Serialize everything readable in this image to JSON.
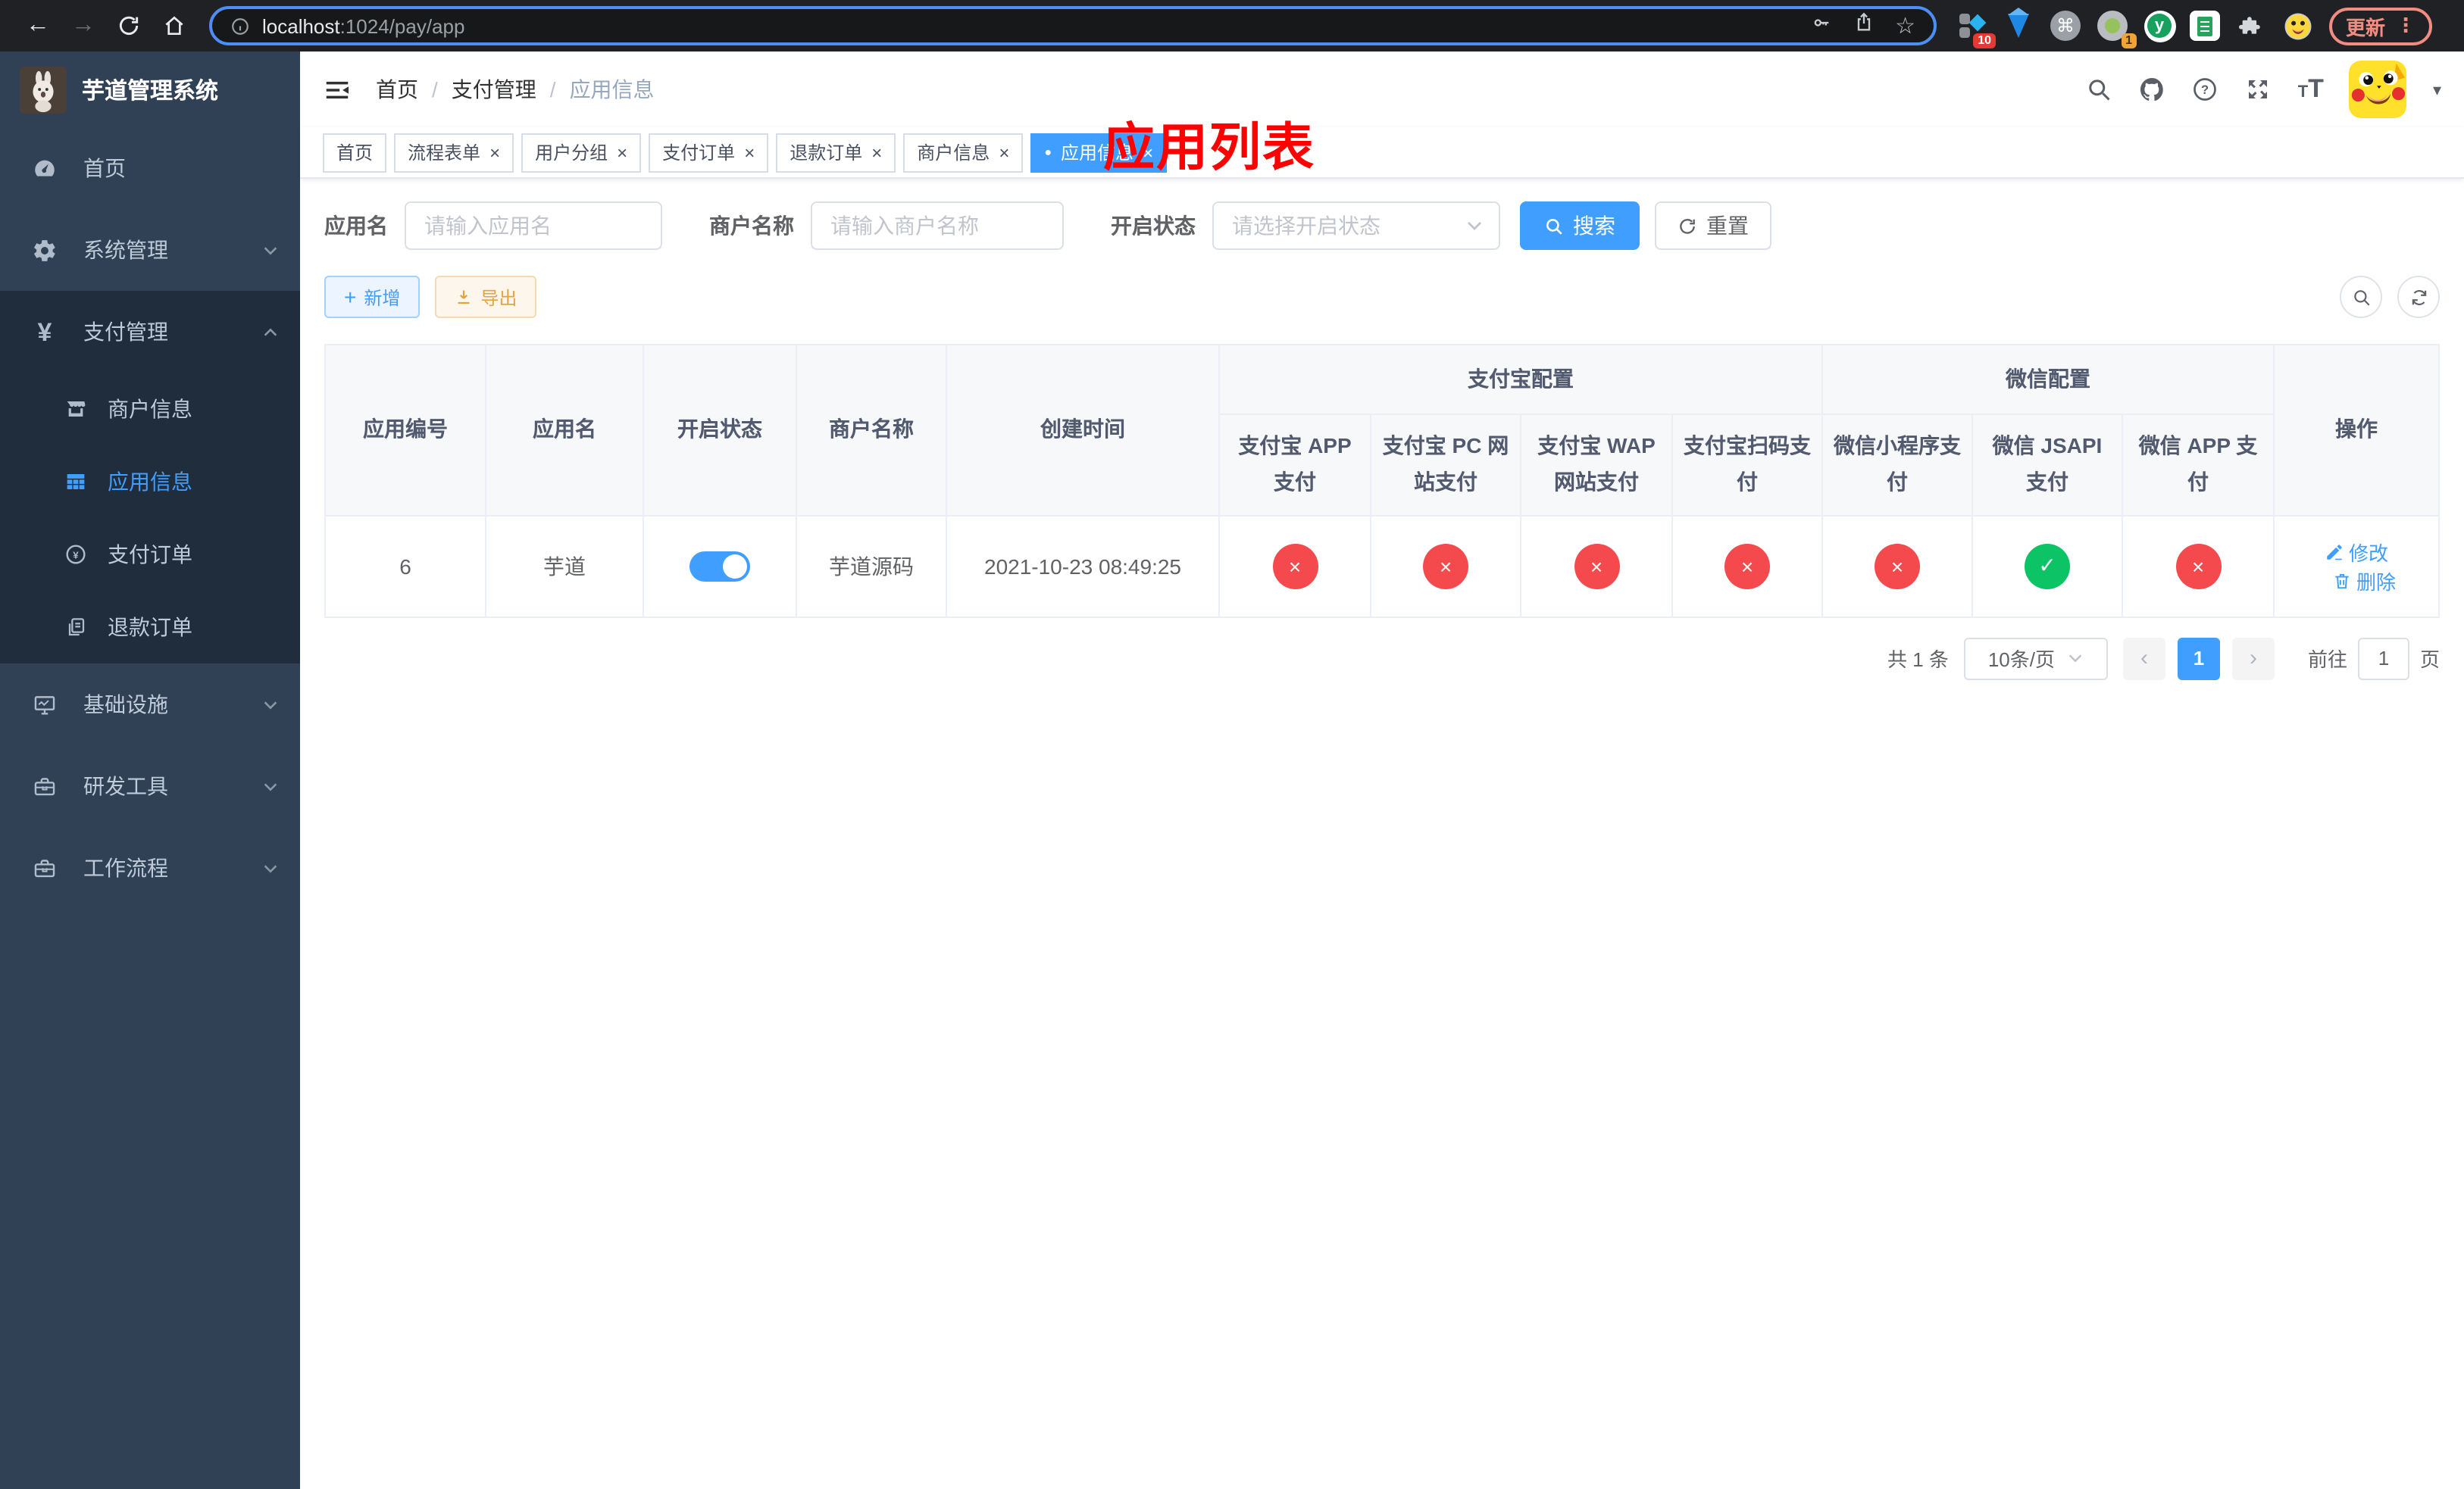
{
  "browser": {
    "url_host": "localhost",
    "url_rest": ":1024/pay/app",
    "update_label": "更新",
    "ext_badge_count": "10",
    "ext_badge_count2": "1",
    "ext_y_letter": "y"
  },
  "sidebar": {
    "title": "芋道管理系统",
    "items": [
      {
        "label": "首页"
      },
      {
        "label": "系统管理"
      },
      {
        "label": "支付管理"
      },
      {
        "label": "基础设施"
      },
      {
        "label": "研发工具"
      },
      {
        "label": "工作流程"
      }
    ],
    "submenu": [
      {
        "label": "商户信息"
      },
      {
        "label": "应用信息"
      },
      {
        "label": "支付订单"
      },
      {
        "label": "退款订单"
      }
    ]
  },
  "navbar": {
    "breadcrumb": [
      "首页",
      "支付管理",
      "应用信息"
    ],
    "annotation": "应用列表"
  },
  "tabs": [
    {
      "label": "首页",
      "closable": false,
      "active": false
    },
    {
      "label": "流程表单",
      "closable": true,
      "active": false
    },
    {
      "label": "用户分组",
      "closable": true,
      "active": false
    },
    {
      "label": "支付订单",
      "closable": true,
      "active": false
    },
    {
      "label": "退款订单",
      "closable": true,
      "active": false
    },
    {
      "label": "商户信息",
      "closable": true,
      "active": false
    },
    {
      "label": "应用信息",
      "closable": true,
      "active": true
    }
  ],
  "filters": {
    "app_name_label": "应用名",
    "app_name_placeholder": "请输入应用名",
    "merchant_label": "商户名称",
    "merchant_placeholder": "请输入商户名称",
    "status_label": "开启状态",
    "status_placeholder": "请选择开启状态",
    "search_label": "搜索",
    "reset_label": "重置"
  },
  "toolbar": {
    "add_label": "新增",
    "export_label": "导出"
  },
  "table": {
    "columns": [
      "应用编号",
      "应用名",
      "开启状态",
      "商户名称",
      "创建时间"
    ],
    "alipay_group": "支付宝配置",
    "alipay_columns": [
      "支付宝 APP 支付",
      "支付宝 PC 网站支付",
      "支付宝 WAP 网站支付",
      "支付宝扫码支付"
    ],
    "wechat_group": "微信配置",
    "wechat_columns": [
      "微信小程序支付",
      "微信 JSAPI 支付",
      "微信 APP 支付"
    ],
    "action_column": "操作",
    "rows": [
      {
        "id": "6",
        "name": "芋道",
        "enabled": true,
        "merchant": "芋道源码",
        "created_at": "2021-10-23 08:49:25",
        "alipay_app": "disabled",
        "alipay_pc": "disabled",
        "alipay_wap": "disabled",
        "alipay_qr": "disabled",
        "wechat_lite": "disabled",
        "wechat_jsapi": "enabled",
        "wechat_app": "disabled",
        "edit_label": "修改",
        "delete_label": "删除"
      }
    ]
  },
  "pagination": {
    "total": "共 1 条",
    "page_size": "10条/页",
    "page": "1",
    "goto_label": "前往",
    "goto_value": "1",
    "goto_unit": "页"
  },
  "icons": {
    "close": "×",
    "check": "✓",
    "back": "←",
    "forward": "→",
    "home": "⌂",
    "star": "☆",
    "plus": "+",
    "yen": "¥",
    "dot": "●",
    "caret": "▾",
    "prev": "‹",
    "next": "›",
    "kebab": "⋮",
    "command": "⌘"
  },
  "colors": {
    "primary": "#409eff",
    "success": "#0cc465",
    "danger": "#f4494d",
    "warning": "#e6a23c",
    "annotation_red": "#ff0000",
    "sidebar_bg": "#304156",
    "submenu_bg": "#1f2d3d"
  }
}
